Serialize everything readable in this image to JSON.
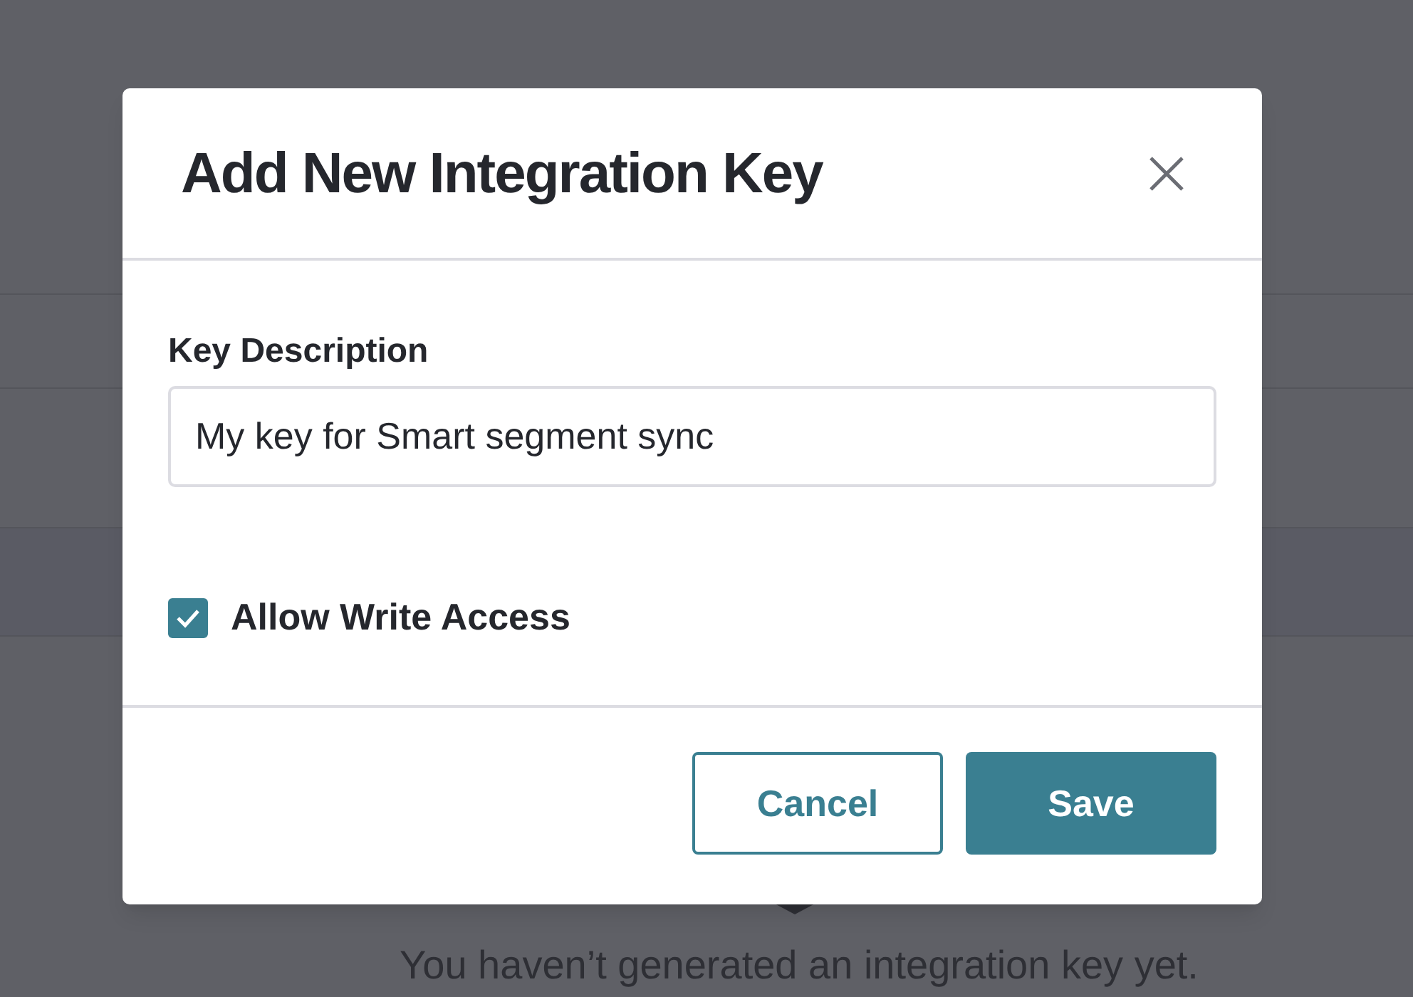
{
  "dialog": {
    "title": "Add New Integration Key",
    "field": {
      "label": "Key Description",
      "value": "My key for Smart segment sync"
    },
    "checkbox": {
      "label": "Allow Write Access",
      "checked": true
    },
    "buttons": [
      {
        "label": "Cancel",
        "kind": "secondary"
      },
      {
        "label": "Save",
        "kind": "primary"
      }
    ]
  },
  "background": {
    "empty_message": "You haven’t generated an integration key yet."
  }
}
